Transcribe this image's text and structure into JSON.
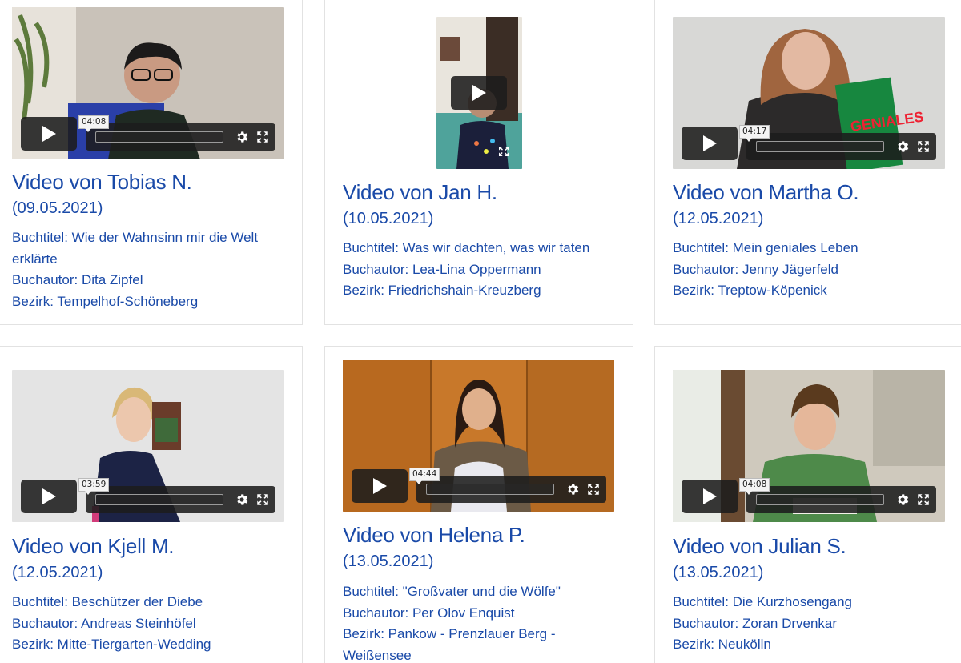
{
  "videos": [
    {
      "title": "Video von Tobias N.",
      "date": "(09.05.2021)",
      "buchtitel": "Buchtitel: Wie der Wahnsinn mir die Welt erklärte",
      "buchautor": "Buchautor: Dita Zipfel",
      "bezirk": "Bezirk: Tempelhof-Schöneberg",
      "duration": "04:08"
    },
    {
      "title": "Video von Jan H.",
      "date": "(10.05.2021)",
      "buchtitel": "Buchtitel: Was wir dachten, was wir taten",
      "buchautor": "Buchautor: Lea-Lina Oppermann",
      "bezirk": "Bezirk: Friedrichshain-Kreuzberg",
      "duration": ""
    },
    {
      "title": "Video von Martha O.",
      "date": "(12.05.2021)",
      "buchtitel": "Buchtitel: Mein geniales Leben",
      "buchautor": "Buchautor: Jenny Jägerfeld",
      "bezirk": "Bezirk: Treptow-Köpenick",
      "duration": "04:17"
    },
    {
      "title": "Video von Kjell M.",
      "date": "(12.05.2021)",
      "buchtitel": "Buchtitel: Beschützer der Diebe",
      "buchautor": "Buchautor: Andreas Steinhöfel",
      "bezirk": "Bezirk: Mitte-Tiergarten-Wedding",
      "duration": "03:59"
    },
    {
      "title": "Video von Helena P.",
      "date": "(13.05.2021)",
      "buchtitel": "Buchtitel: \"Großvater und die Wölfe\"",
      "buchautor": "Buchautor: Per Olov Enquist",
      "bezirk": "Bezirk: Pankow - Prenzlauer Berg - Weißensee",
      "duration": "04:44"
    },
    {
      "title": "Video von Julian S.",
      "date": "(13.05.2021)",
      "buchtitel": "Buchtitel: Die Kurzhosengang",
      "buchautor": "Buchautor: Zoran Drvenkar",
      "bezirk": "Bezirk: Neukölln",
      "duration": "04:08"
    }
  ],
  "icons": {
    "play": "play-icon",
    "settings": "gear-icon",
    "fullscreen": "fullscreen-icon"
  },
  "colors": {
    "text": "#1a4aa8",
    "controls": "#1c1c1c",
    "border": "#e2e2e2"
  }
}
